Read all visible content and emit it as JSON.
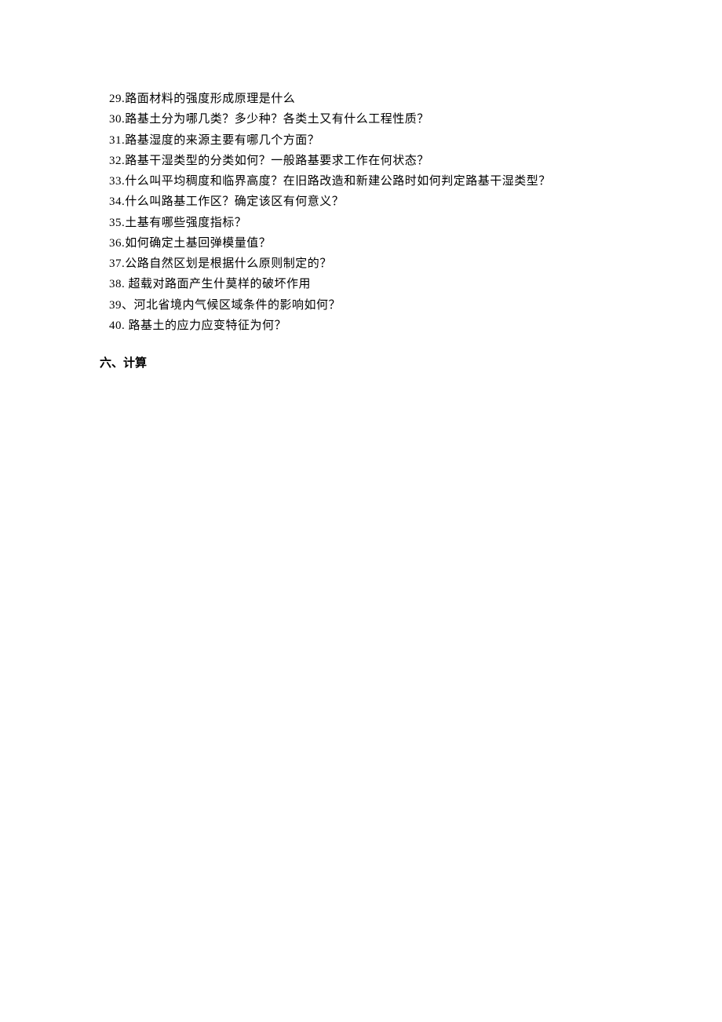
{
  "questions": {
    "q29": "29.路面材料的强度形成原理是什么",
    "q30": "30.路基土分为哪几类？多少种？各类土又有什么工程性质？",
    "q31": "31.路基湿度的来源主要有哪几个方面？",
    "q32": "32.路基干湿类型的分类如何？一般路基要求工作在何状态？",
    "q33": "33.什么叫平均稠度和临界高度？在旧路改造和新建公路时如何判定路基干湿类型？",
    "q34": "34.什么叫路基工作区？确定该区有何意义？",
    "q35": "35.土基有哪些强度指标？",
    "q36": "36.如何确定土基回弹模量值？",
    "q37": "37.公路自然区划是根据什么原则制定的？",
    "q38": "38.  超载对路面产生什莫样的破坏作用",
    "q39": "39、河北省境内气候区域条件的影响如何？",
    "q40": "40.  路基土的应力应变特征为何？"
  },
  "section": {
    "heading": "六、计算"
  }
}
